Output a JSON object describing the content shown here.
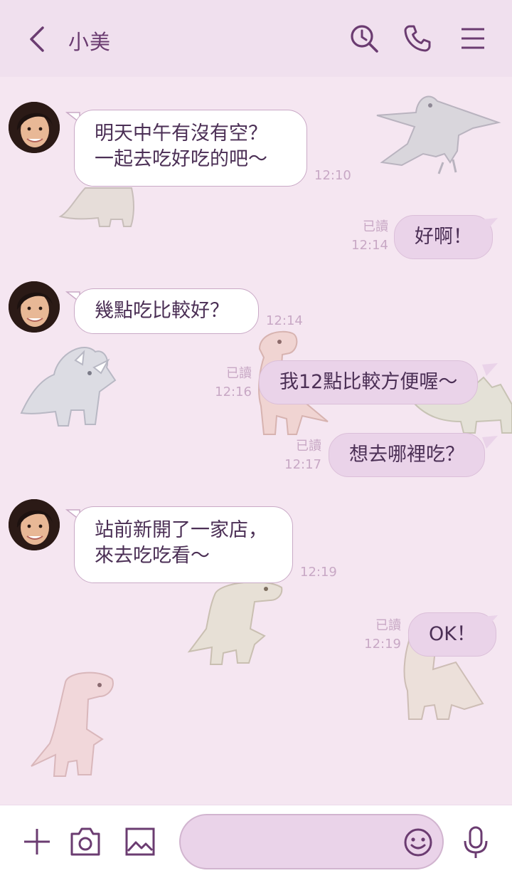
{
  "header": {
    "title": "小美",
    "icons": {
      "back": "chevron-left-icon",
      "search": "clock-search-icon",
      "call": "phone-icon",
      "menu": "menu-icon"
    }
  },
  "messages": [
    {
      "side": "in",
      "text": "明天中午有沒有空？\n一起去吃好吃的吧～",
      "time": "12:10"
    },
    {
      "side": "out",
      "text": "好啊！",
      "read": "已讀",
      "time": "12:14"
    },
    {
      "side": "in",
      "text": "幾點吃比較好？",
      "time": "12:14"
    },
    {
      "side": "out",
      "text": "我12點比較方便喔～",
      "read": "已讀",
      "time": "12:16"
    },
    {
      "side": "out",
      "text": "想去哪裡吃？",
      "read": "已讀",
      "time": "12:17"
    },
    {
      "side": "in",
      "text": "站前新開了一家店，\n來去吃吃看～",
      "time": "12:19"
    },
    {
      "side": "out",
      "text": "OK！",
      "read": "已讀",
      "time": "12:19"
    }
  ],
  "bottom": {
    "input_value": "",
    "icons": {
      "plus": "plus-icon",
      "camera": "camera-icon",
      "image": "image-icon",
      "emoji": "smiley-icon",
      "mic": "microphone-icon"
    }
  },
  "colors": {
    "background": "#f5e6f1",
    "header": "#f0e0ee",
    "accent": "#6b3c71",
    "bubble_out": "#ead3e9",
    "bubble_in": "#ffffff",
    "meta_text": "#c8a8c5"
  }
}
